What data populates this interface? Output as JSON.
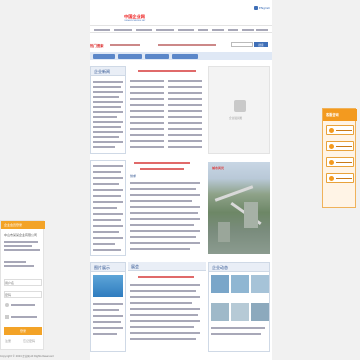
{
  "header": {
    "logo_title": "中国企业网",
    "logo_sub": "CHINA ENTERPRISE NET",
    "logo_en": "ENglish"
  },
  "nav": {
    "items": [
      "首页",
      "企业会员",
      "商务会员",
      "企业展厅",
      "商务中心",
      "展会",
      "资讯",
      "招商",
      "论坛",
      "企业注册"
    ],
    "active": "首页"
  },
  "search": {
    "placeholder": "",
    "hot_label": "热门搜索",
    "button": "搜索"
  },
  "sidebar_left": {
    "title": "企业会员登录",
    "company": "中山市某某企业有限公司",
    "username_placeholder": "用户名",
    "password_placeholder": "密码",
    "login_button": "登录",
    "register_link": "注册",
    "forgot_link": "忘记密码"
  },
  "section_titles": {
    "news": "企业新闻",
    "notice": "公告",
    "products": "供求",
    "photos": "图片展示",
    "exhibit": "展会",
    "bottom": "企业动态"
  },
  "right_bar": {
    "title": "客服咨询",
    "items": [
      "在线咨询",
      "电话咨询",
      "留言咨询",
      "企业客服"
    ]
  },
  "image_caption": "企业展示图",
  "map_caption": "城市风光",
  "footer": {
    "status": "Copyright © 2024 企业网 All Rights Reserved"
  }
}
